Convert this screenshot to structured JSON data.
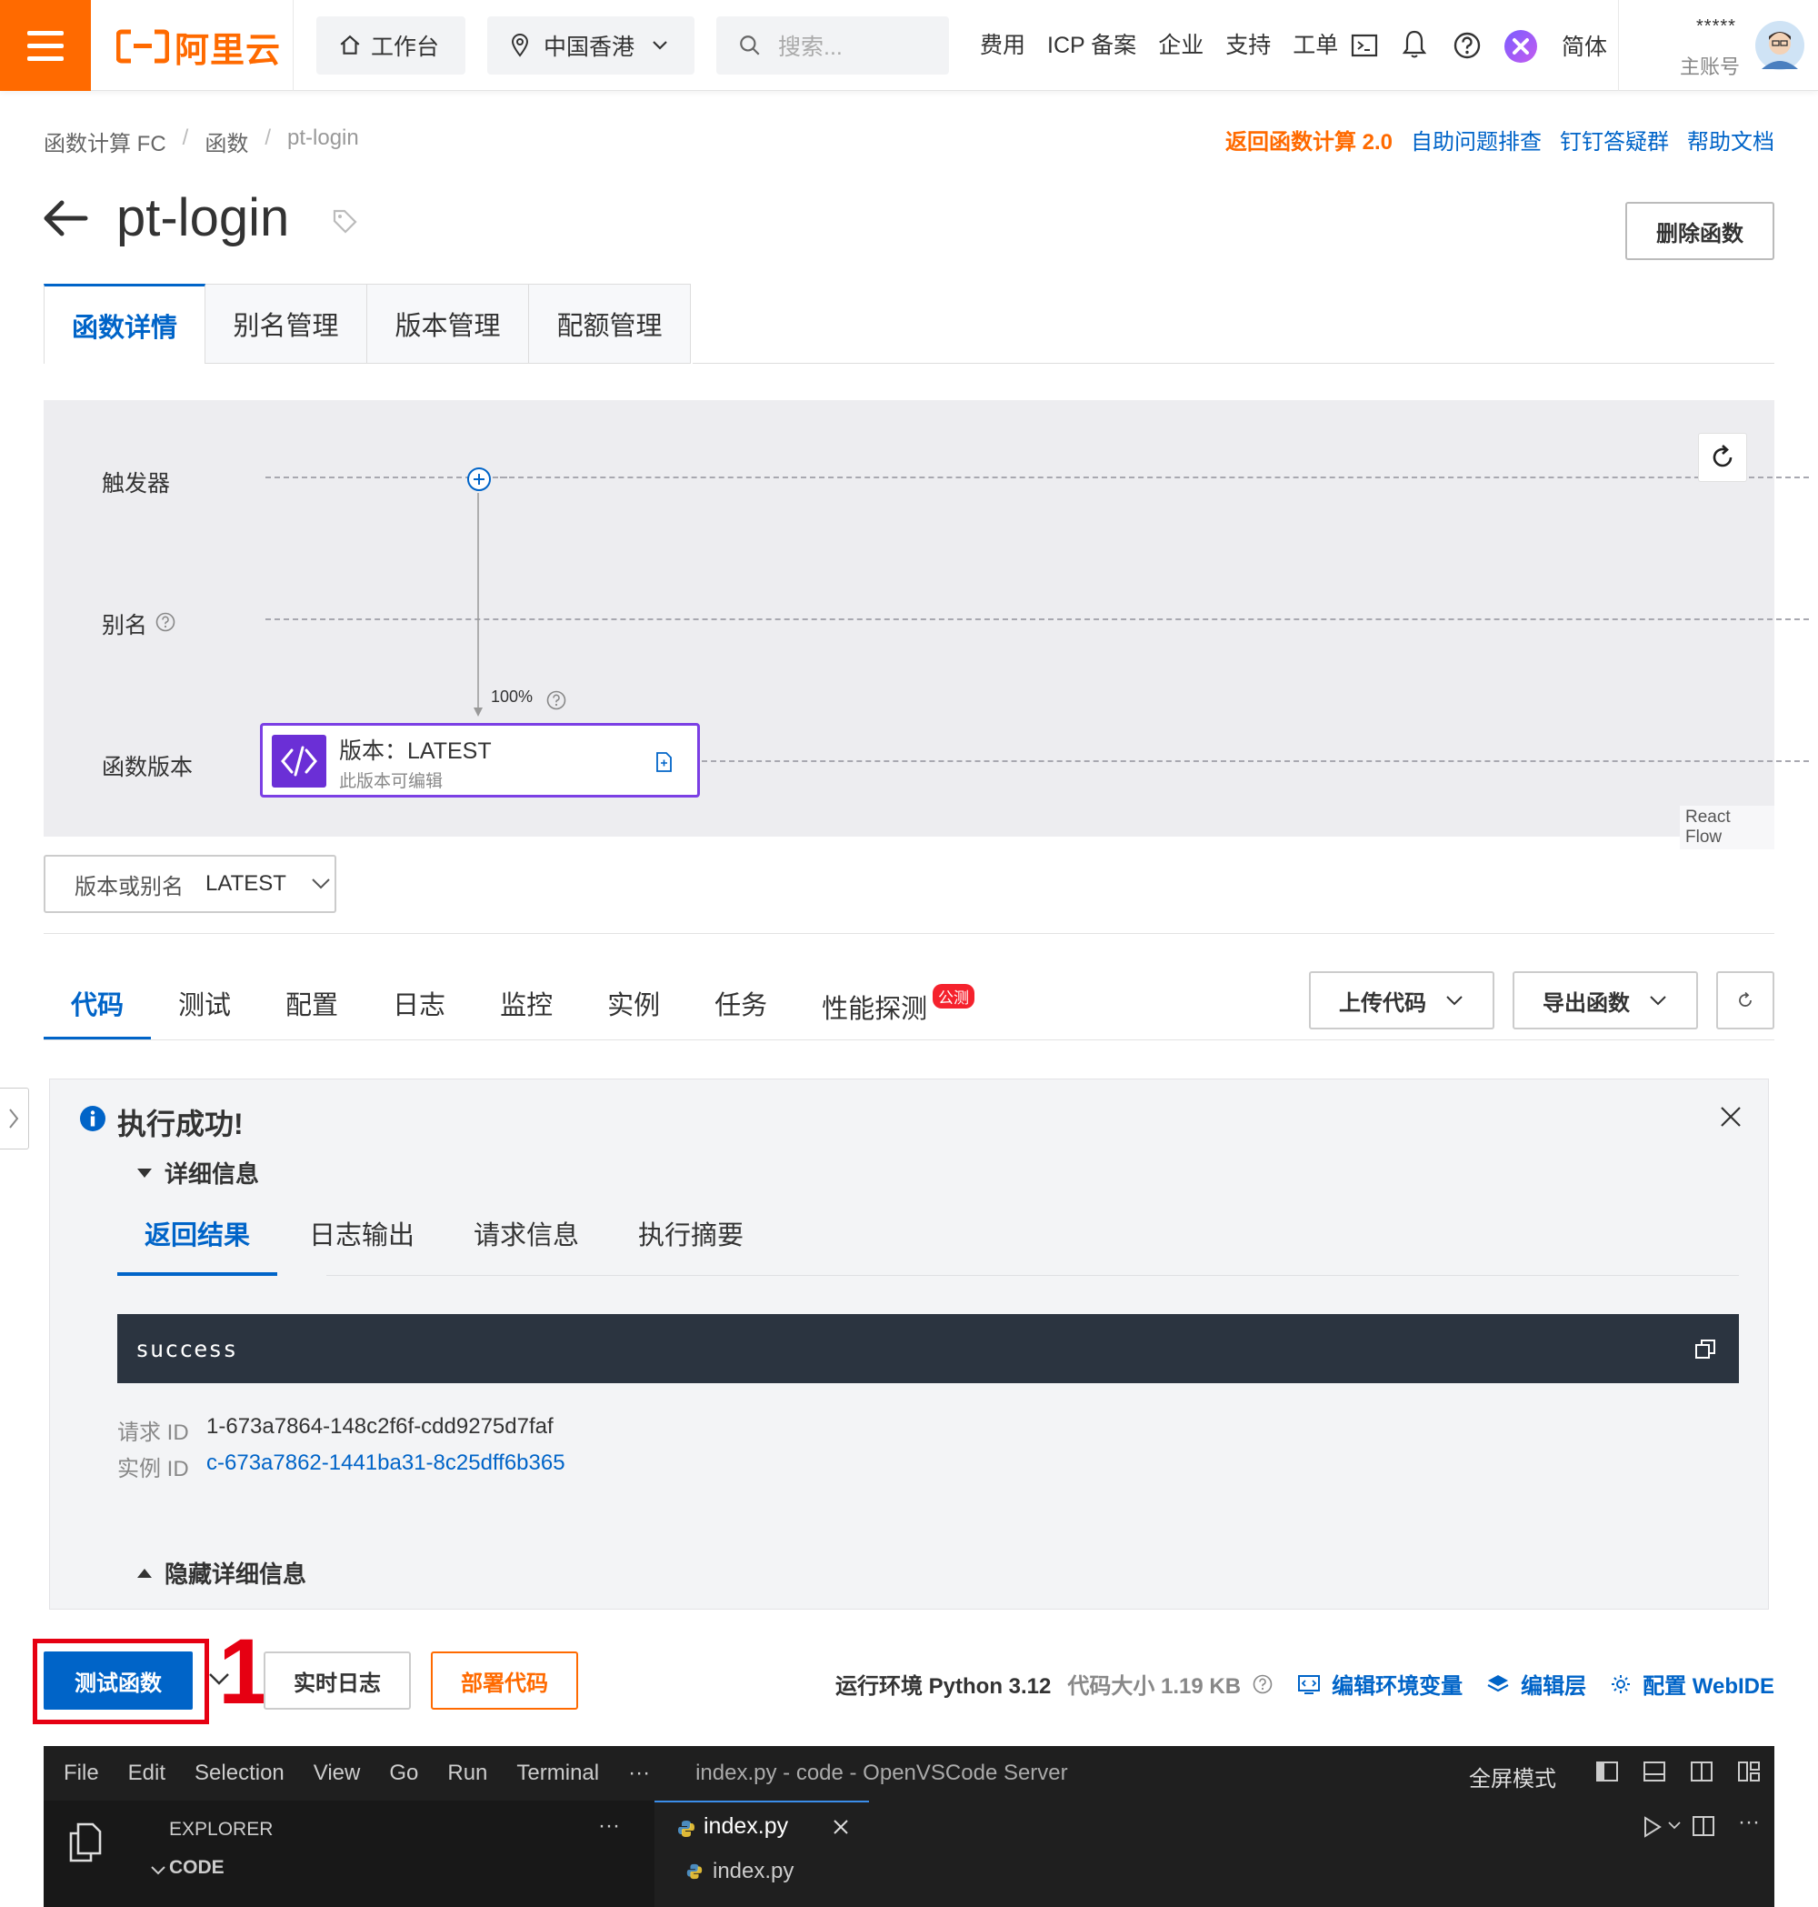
{
  "topbar": {
    "brand": "阿里云",
    "workbench": "工作台",
    "region": "中国香港",
    "search_placeholder": "搜索...",
    "links": [
      "费用",
      "ICP 备案",
      "企业",
      "支持",
      "工单"
    ],
    "lang": "简体",
    "account_masked": "*****",
    "account_role": "主账号"
  },
  "breadcrumb": [
    "函数计算 FC",
    "函数",
    "pt-login"
  ],
  "quick_links": {
    "back_v2": "返回函数计算 2.0",
    "troubleshoot": "自助问题排查",
    "dingtalk": "钉钉答疑群",
    "docs": "帮助文档"
  },
  "page": {
    "title": "pt-login",
    "delete_label": "删除函数",
    "tabs": [
      "函数详情",
      "别名管理",
      "版本管理",
      "配额管理"
    ]
  },
  "flow": {
    "rows": [
      "触发器",
      "别名",
      "函数版本"
    ],
    "traffic": "100%",
    "version_title": "版本：LATEST",
    "version_sub": "此版本可编辑",
    "attribution": "React Flow"
  },
  "version_select": {
    "label": "版本或别名",
    "value": "LATEST"
  },
  "sub_tabs": [
    "代码",
    "测试",
    "配置",
    "日志",
    "监控",
    "实例",
    "任务",
    "性能探测"
  ],
  "beta_badge": "公测",
  "actions": {
    "upload": "上传代码",
    "export": "导出函数"
  },
  "result": {
    "title": "执行成功!",
    "details_toggle": "详细信息",
    "tabs": [
      "返回结果",
      "日志输出",
      "请求信息",
      "执行摘要"
    ],
    "output": "success",
    "request_id_label": "请求 ID",
    "request_id": "1-673a7864-148c2f6f-cdd9275d7faf",
    "instance_id_label": "实例 ID",
    "instance_id": "c-673a7862-1441ba31-8c25dff6b365",
    "hide_details": "隐藏详细信息"
  },
  "bottom": {
    "test_fn": "测试函数",
    "annotation_number": "1",
    "realtime_log": "实时日志",
    "deploy": "部署代码",
    "runtime": "运行环境 Python 3.12",
    "code_size": "代码大小 1.19 KB",
    "edit_env": "编辑环境变量",
    "edit_layer": "编辑层",
    "config_webide": "配置 WebIDE"
  },
  "vscode": {
    "menu": [
      "File",
      "Edit",
      "Selection",
      "View",
      "Go",
      "Run",
      "Terminal",
      "···"
    ],
    "window_title": "index.py - code - OpenVSCode Server",
    "fullscreen": "全屏模式",
    "explorer_label": "EXPLORER",
    "explorer_more": "···",
    "folder": "CODE",
    "tab_file": "index.py",
    "breadcrumb_file": "index.py"
  },
  "colors": {
    "brand_orange": "#ff6a00",
    "primary_blue": "#0064c8",
    "annotation_red": "#e60012",
    "version_purple": "#7b3fe4"
  }
}
